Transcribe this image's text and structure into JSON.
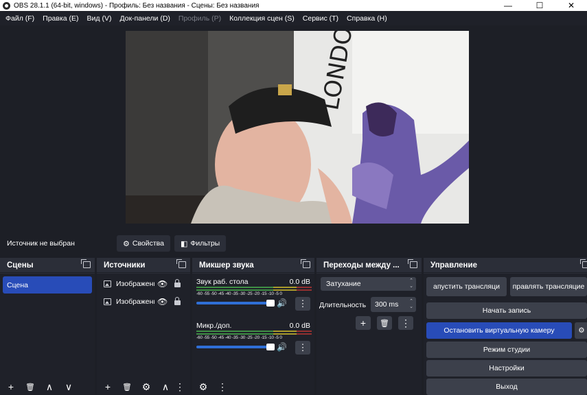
{
  "window": {
    "title": "OBS 28.1.1 (64-bit, windows) - Профиль: Без названия - Сцены: Без названия",
    "minimize": "—",
    "maximize": "☐",
    "close": "✕"
  },
  "menu": [
    {
      "label": "Файл (F)",
      "enabled": true
    },
    {
      "label": "Правка (E)",
      "enabled": true
    },
    {
      "label": "Вид (V)",
      "enabled": true
    },
    {
      "label": "Док-панели (D)",
      "enabled": true
    },
    {
      "label": "Профиль (P)",
      "enabled": false
    },
    {
      "label": "Коллекция сцен (S)",
      "enabled": true
    },
    {
      "label": "Сервис (T)",
      "enabled": true
    },
    {
      "label": "Справка (H)",
      "enabled": true
    }
  ],
  "preview": {
    "poster_text": "LONDON"
  },
  "sourcebar": {
    "no_source": "Источник не выбран",
    "properties": "Свойства",
    "filters": "Фильтры"
  },
  "scenes": {
    "title": "Сцены",
    "items": [
      "Сцена"
    ],
    "selected_index": 0
  },
  "sources": {
    "title": "Источники",
    "items": [
      {
        "name": "Изображение",
        "visible": true,
        "locked": true
      },
      {
        "name": "Изображение",
        "visible": true,
        "locked": true
      }
    ]
  },
  "mixer": {
    "title": "Микшер звука",
    "scale": "-60 -55 -50 -45 -40 -35 -30 -25 -20 -15 -10 -5 0",
    "channels": [
      {
        "name": "Звук раб. стола",
        "db": "0.0 dB",
        "volume": 1.0
      },
      {
        "name": "Микр./доп.",
        "db": "0.0 dB",
        "volume": 1.0
      }
    ]
  },
  "transitions": {
    "title": "Переходы между ...",
    "selected": "Затухание",
    "duration_label": "Длительность",
    "duration_value": "300 ms"
  },
  "controls": {
    "title": "Управление",
    "start_stream": "апустить трансляци",
    "manage_stream": "правлять трансляцие",
    "start_record": "Начать запись",
    "stop_virtualcam": "Остановить виртуальную камеру",
    "studio_mode": "Режим студии",
    "settings": "Настройки",
    "exit": "Выход"
  },
  "colors": {
    "accent": "#284cb8",
    "panel": "#2b2e38",
    "background": "#1d1f26",
    "meter_green": "#4caf50",
    "meter_yellow": "#c9b62e",
    "meter_red": "#b33a3a"
  },
  "icons": {
    "gear": "⚙",
    "filter": "◧",
    "eye": "👁",
    "plus": "+",
    "trash": "🗑",
    "up": "∧",
    "down": "∨",
    "dots": "⋮",
    "volume": "🔊"
  }
}
